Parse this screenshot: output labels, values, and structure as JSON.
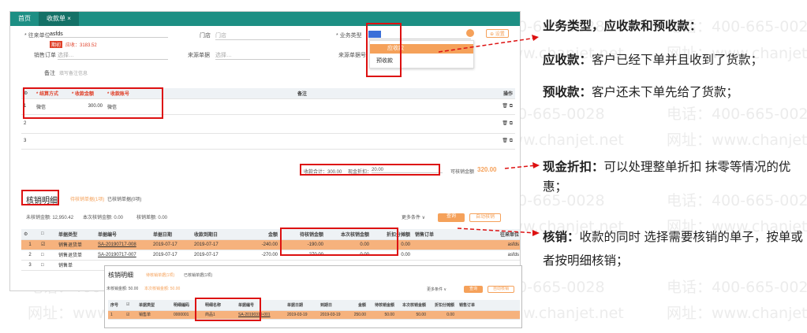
{
  "watermark": {
    "phone": "电话：400-665-0028",
    "site": "网址：www.chanjet.net"
  },
  "tabs": [
    "首页",
    "收款单 ×"
  ],
  "form": {
    "customer_label": "* 往来单位",
    "customer_value": "asfds",
    "badge": "期初",
    "balance": "应收：3183.52",
    "store_label": "门店",
    "store_placeholder": "门店",
    "bizType_label": "* 业务类型",
    "bizType_value": "应收款",
    "settings": "⊕ 设置",
    "order_label": "销售订单",
    "order_placeholder": "选择…",
    "src_label": "来源单据",
    "src_placeholder": "选择…",
    "srcno_label": "来源单据号",
    "remark_label": "备注",
    "remark_placeholder": "填写备注信息"
  },
  "dropdown": [
    "应收款",
    "预收款"
  ],
  "pay_table": {
    "headers": [
      "⚙",
      "* 结算方式",
      "* 收款金额",
      "* 收款账号",
      "备注",
      "操作"
    ],
    "rows": [
      [
        "1",
        "微信",
        "300.00",
        "微信"
      ],
      [
        "2",
        "",
        "",
        ""
      ],
      [
        "3",
        "",
        "",
        ""
      ]
    ],
    "ops": "🗑 ⧉"
  },
  "totals": {
    "received": "收款合计：300.00",
    "discount_label": "现金折扣：",
    "discount_value": "20.00",
    "writeoff_label": "可核销金额",
    "writeoff_value": "320.00"
  },
  "verify": {
    "title": "核销明细",
    "tab1": "待核销单据(1项)",
    "tab2": "已核销单据(0项)",
    "summary": [
      "未核销金额: 12,950.42",
      "本次核销金额: 0.00",
      "核销差额: 0.00"
    ],
    "more": "更多条件 ∨",
    "query": "查询",
    "auto": "自动核销"
  },
  "verify_table": {
    "headers": [
      "⚙",
      "□",
      "单据类型",
      "单据编号",
      "单据日期",
      "收款到期日",
      "金额",
      "待核销金额",
      "本次核销金额",
      "折扣分摊额",
      "销售订单",
      "往来单位"
    ],
    "rows": [
      [
        "1",
        "☑",
        "销售退货单",
        "SA-20190717-008",
        "2019-07-17",
        "2019-07-17",
        "-240.00",
        "-190.00",
        "0.00",
        "0.00",
        "",
        "asfds"
      ],
      [
        "2",
        "□",
        "销售退货单",
        "SA-20190717-007",
        "2019-07-17",
        "2019-07-17",
        "-270.00",
        "-270.00",
        "0.00",
        "0.00",
        "",
        "asfds"
      ],
      [
        "3",
        "□",
        "销售单",
        "",
        "",
        "",
        "",
        "",
        "",
        "",
        "",
        ""
      ]
    ]
  },
  "detail": {
    "title": "核销明细",
    "tab1": "待核销单据(1项)",
    "tab2": "已核销单据(1项)",
    "summary": [
      "未核销金额: 50.00",
      "本次核销金额: 50.00"
    ],
    "more": "更多条件 ∨",
    "query": "查询",
    "auto": "自动核销",
    "headers": [
      "序号",
      "☑",
      "单据类型",
      "明细编码",
      "明细名称",
      "单据编号",
      "单据日期",
      "到期日",
      "金额",
      "待核销金额",
      "本次核销金额",
      "折扣分摊额",
      "销售订单"
    ],
    "row": [
      "1",
      "☑",
      "销售单",
      "0000001",
      "商品1",
      "SA-20190319-001",
      "2019-03-19",
      "2019-03-19",
      "250.00",
      "50.00",
      "50.00",
      "0.00",
      ""
    ]
  },
  "notes": {
    "n1": "业务类型，应收款和预收款：",
    "n2_b": "应收款：",
    "n2": "客户已经下单并且收到了货款；",
    "n3_b": "预收款：",
    "n3": "客户还未下单先给了货款；",
    "n4_b": "现金折扣：",
    "n4": "可以处理整单折扣 抹零等情况的优惠；",
    "n5_b": "核销：",
    "n5": "收款的同时 选择需要核销的单子，按单或者按明细核销；"
  },
  "colors": {
    "teal": "#1d8f84",
    "orange": "#f5a15a",
    "highlight": "#d11"
  }
}
